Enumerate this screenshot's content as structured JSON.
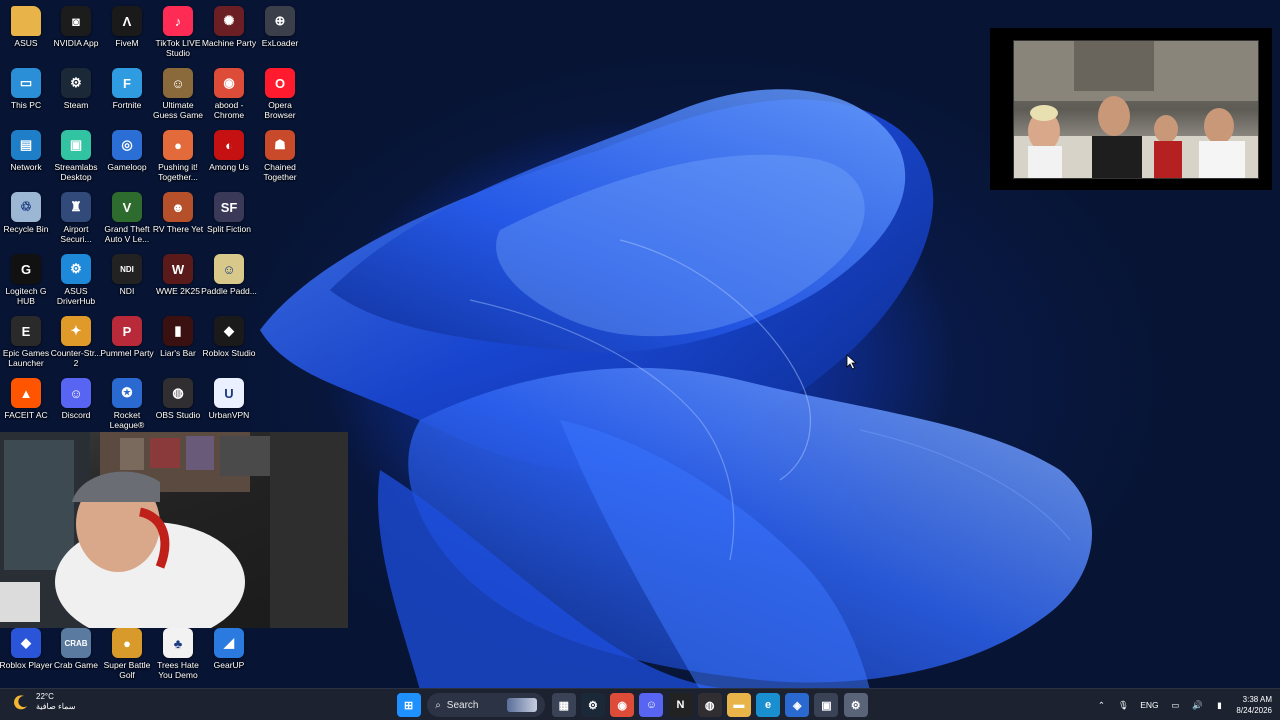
{
  "desktop_icons": [
    {
      "label": "ASUS",
      "icon": "folder-icon",
      "color": "#e8b44a",
      "glyph": ""
    },
    {
      "label": "NVIDIA App",
      "icon": "nvidia-icon",
      "color": "#1c1c1c",
      "glyph": "◙"
    },
    {
      "label": "FiveM",
      "icon": "fivem-icon",
      "color": "#1a1a1a",
      "glyph": "Λ"
    },
    {
      "label": "TikTok LIVE Studio",
      "icon": "tiktok-icon",
      "color": "#fe2c55",
      "glyph": "♪"
    },
    {
      "label": "Machine Party",
      "icon": "machine-party-icon",
      "color": "#6b1f24",
      "glyph": "✺"
    },
    {
      "label": "ExLoader",
      "icon": "exloader-icon",
      "color": "#3a3f4a",
      "glyph": "⊕"
    },
    {
      "label": "This PC",
      "icon": "monitor-icon",
      "color": "#2a8fd6",
      "glyph": "▭"
    },
    {
      "label": "Steam",
      "icon": "steam-icon",
      "color": "#1b2838",
      "glyph": "⚙"
    },
    {
      "label": "Fortnite",
      "icon": "fortnite-icon",
      "color": "#2f9be0",
      "glyph": "F"
    },
    {
      "label": "Ultimate Guess Game",
      "icon": "ultimate-guess-icon",
      "color": "#8a6a3a",
      "glyph": "☺"
    },
    {
      "label": "abood - Chrome",
      "icon": "chrome-icon",
      "color": "#dd4b39",
      "glyph": "◉"
    },
    {
      "label": "Opera Browser",
      "icon": "opera-icon",
      "color": "#ff1b2d",
      "glyph": "O"
    },
    {
      "label": "Network",
      "icon": "network-icon",
      "color": "#1e7fc8",
      "glyph": "▤"
    },
    {
      "label": "Streamlabs Desktop",
      "icon": "streamlabs-icon",
      "color": "#31c3a2",
      "glyph": "▣"
    },
    {
      "label": "Gameloop",
      "icon": "gameloop-icon",
      "color": "#2b6fd6",
      "glyph": "◎"
    },
    {
      "label": "Pushing it! Together...",
      "icon": "pushing-it-icon",
      "color": "#e36a3a",
      "glyph": "●"
    },
    {
      "label": "Among Us",
      "icon": "among-us-icon",
      "color": "#c51111",
      "glyph": "◐"
    },
    {
      "label": "Chained Together",
      "icon": "chained-together-icon",
      "color": "#c84a2a",
      "glyph": "☗"
    },
    {
      "label": "Recycle Bin",
      "icon": "recycle-bin-icon",
      "color": "#9bb7d4",
      "glyph": "♲"
    },
    {
      "label": "Airport Securi...",
      "icon": "airport-security-icon",
      "color": "#314a7a",
      "glyph": "♜"
    },
    {
      "label": "Grand Theft Auto V Le...",
      "icon": "gta-icon",
      "color": "#2e6b2e",
      "glyph": "V"
    },
    {
      "label": "RV There Yet",
      "icon": "rv-there-yet-icon",
      "color": "#b5502a",
      "glyph": "☻"
    },
    {
      "label": "Split Fiction",
      "icon": "split-fiction-icon",
      "color": "#3a3a58",
      "glyph": "SF"
    },
    {
      "label": "Logitech G HUB",
      "icon": "logitech-icon",
      "color": "#111111",
      "glyph": "G"
    },
    {
      "label": "ASUS DriverHub",
      "icon": "asus-driverhub-icon",
      "color": "#1e88d9",
      "glyph": "⚙"
    },
    {
      "label": "NDI",
      "icon": "ndi-icon",
      "color": "#222222",
      "glyph": "NDI"
    },
    {
      "label": "WWE 2K25",
      "icon": "wwe-icon",
      "color": "#5a1a1a",
      "glyph": "W"
    },
    {
      "label": "Paddle Padd...",
      "icon": "paddle-icon",
      "color": "#d8c98a",
      "glyph": "☺"
    },
    {
      "label": "Epic Games Launcher",
      "icon": "epic-games-icon",
      "color": "#2a2a2a",
      "glyph": "E"
    },
    {
      "label": "Counter-Str... 2",
      "icon": "counter-strike-icon",
      "color": "#e09a2a",
      "glyph": "✦"
    },
    {
      "label": "Pummel Party",
      "icon": "pummel-party-icon",
      "color": "#b82a3a",
      "glyph": "P"
    },
    {
      "label": "Liar's Bar",
      "icon": "liars-bar-icon",
      "color": "#3a1010",
      "glyph": "▮"
    },
    {
      "label": "Roblox Studio",
      "icon": "roblox-studio-icon",
      "color": "#1a1a1a",
      "glyph": "◆"
    },
    {
      "label": "FACEIT AC",
      "icon": "faceit-icon",
      "color": "#ff5500",
      "glyph": "▲"
    },
    {
      "label": "Discord",
      "icon": "discord-icon",
      "color": "#5865f2",
      "glyph": "☺"
    },
    {
      "label": "Rocket League®",
      "icon": "rocket-league-icon",
      "color": "#2a6ad0",
      "glyph": "✪"
    },
    {
      "label": "OBS Studio",
      "icon": "obs-icon",
      "color": "#302e31",
      "glyph": "◍"
    },
    {
      "label": "UrbanVPN",
      "icon": "urbanvpn-icon",
      "color": "#eaf0ff",
      "glyph": "U"
    },
    {
      "label": "Roblox Player",
      "icon": "roblox-player-icon",
      "color": "#2a55d8",
      "glyph": "◆"
    },
    {
      "label": "Crab Game",
      "icon": "crab-game-icon",
      "color": "#5a7aa0",
      "glyph": "CRAB"
    },
    {
      "label": "Super Battle Golf",
      "icon": "super-battle-golf-icon",
      "color": "#d89a2a",
      "glyph": "●"
    },
    {
      "label": "Trees Hate You Demo",
      "icon": "trees-hate-you-icon",
      "color": "#f2f2f2",
      "glyph": "♣"
    },
    {
      "label": "GearUP",
      "icon": "gearup-icon",
      "color": "#2a7ae0",
      "glyph": "◢"
    }
  ],
  "taskbar": {
    "weather_temp": "22°C",
    "weather_desc": "سماء صافية",
    "search_label": "Search",
    "apps": [
      {
        "name": "windows-start-icon",
        "color": "#1e90ff",
        "glyph": "⊞"
      },
      {
        "name": "file-explorer-tasks-icon",
        "color": "#3a4256",
        "glyph": "▦"
      },
      {
        "name": "steam-taskbar-icon",
        "color": "#1b2838",
        "glyph": "⚙"
      },
      {
        "name": "chrome-taskbar-icon",
        "color": "#dd4b39",
        "glyph": "◉"
      },
      {
        "name": "discord-taskbar-icon",
        "color": "#5865f2",
        "glyph": "☺"
      },
      {
        "name": "ndi-taskbar-icon",
        "color": "#222222",
        "glyph": "N"
      },
      {
        "name": "obs-taskbar-icon",
        "color": "#302e31",
        "glyph": "◍"
      },
      {
        "name": "folder-taskbar-icon",
        "color": "#e8b44a",
        "glyph": "▬"
      },
      {
        "name": "edge-taskbar-icon",
        "color": "#1a8fd0",
        "glyph": "e"
      },
      {
        "name": "store-taskbar-icon",
        "color": "#2a6ad0",
        "glyph": "◈"
      },
      {
        "name": "calendar-taskbar-icon",
        "color": "#3a4256",
        "glyph": "▣"
      },
      {
        "name": "settings-taskbar-icon",
        "color": "#5a6478",
        "glyph": "⚙"
      }
    ],
    "language": "ENG",
    "time": "3:38 AM",
    "date": "8/24/2026"
  }
}
